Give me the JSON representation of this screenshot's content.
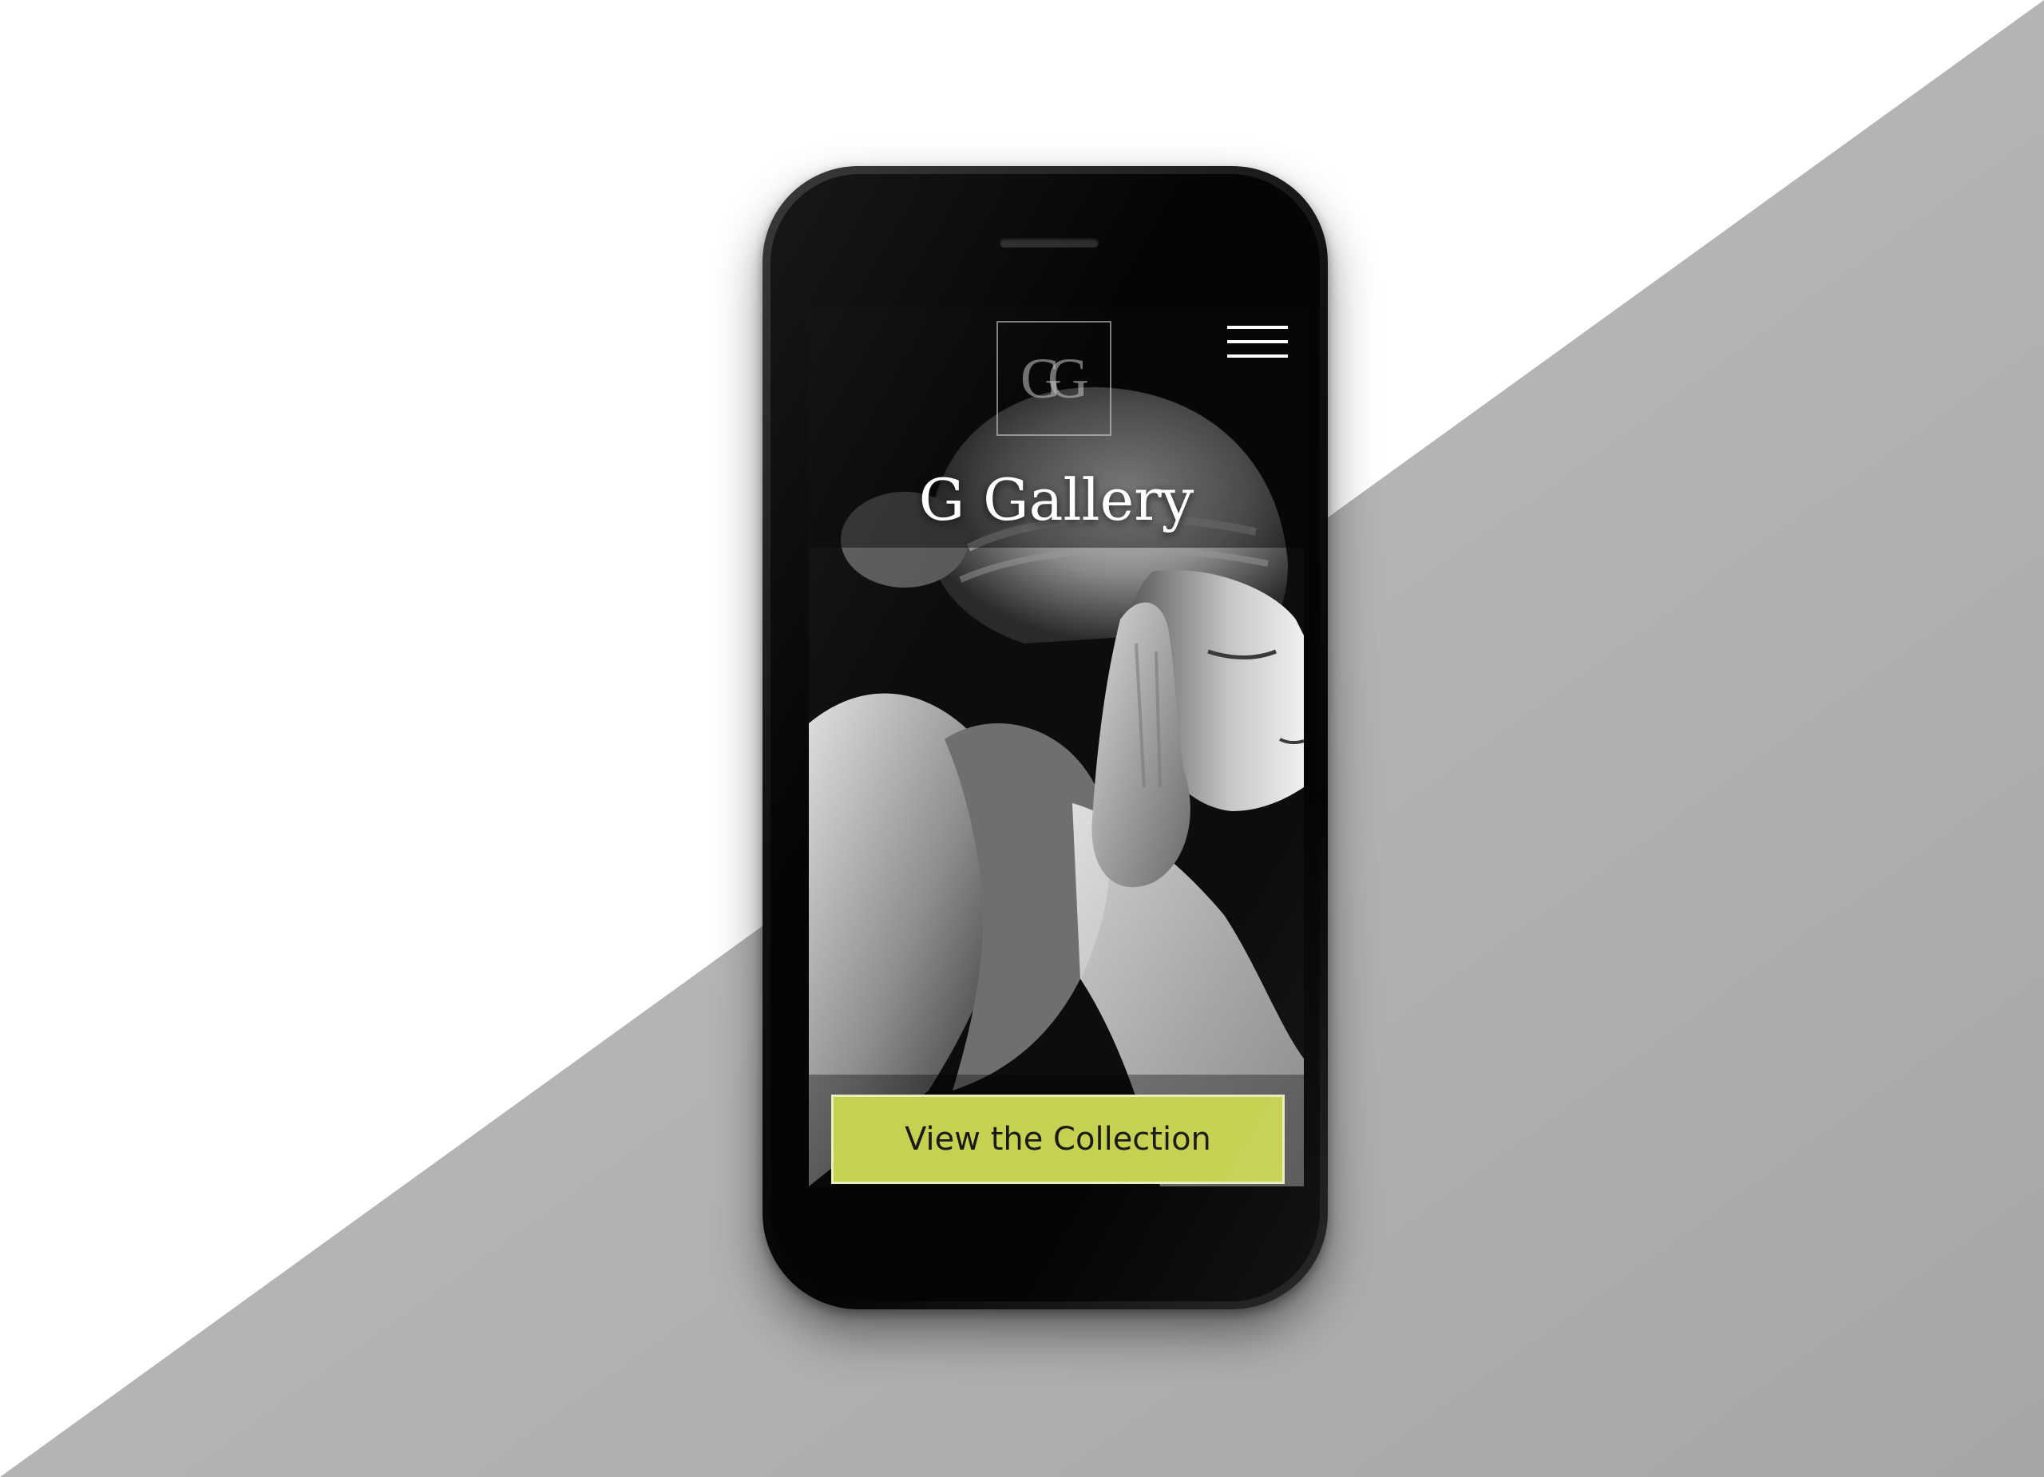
{
  "site": {
    "title": "G Gallery",
    "logo_mark": "GG",
    "menu_icon": "hamburger-menu-icon"
  },
  "hero": {
    "image": "classical-marble-sculpture-photo",
    "cta_label": "View the Collection"
  },
  "colors": {
    "accent": "#c6d151",
    "background_light": "#ffffff",
    "background_gray": "#b0b0b0",
    "screen_dark": "#0d0d0d"
  }
}
